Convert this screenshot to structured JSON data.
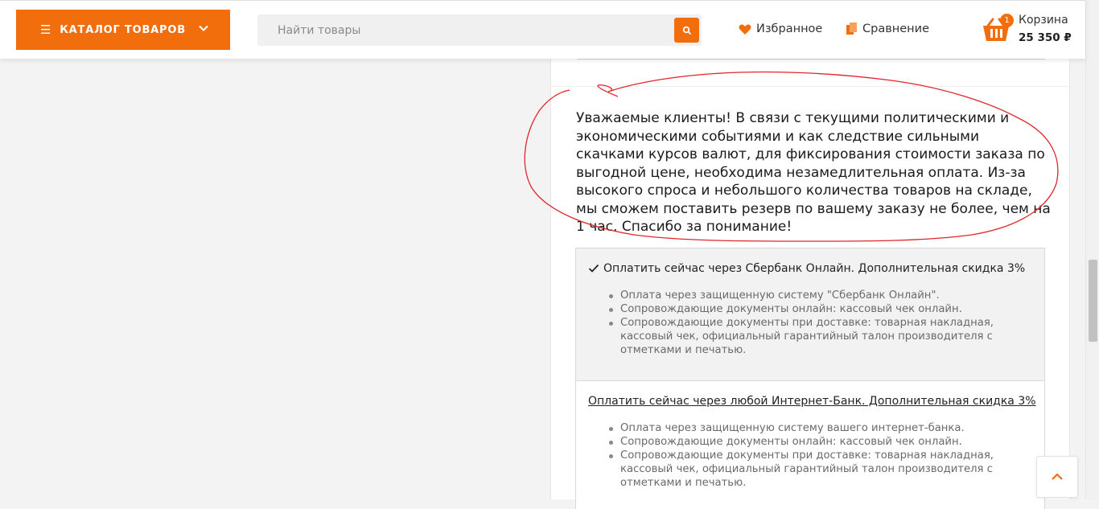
{
  "header": {
    "catalog_label": "КАТАЛОГ ТОВАРОВ",
    "search_placeholder": "Найти товары",
    "favorites_label": "Избранное",
    "compare_label": "Сравнение",
    "cart": {
      "label": "Корзина",
      "count": "1",
      "total": "25 350 ₽"
    }
  },
  "notice": {
    "text": "Уважаемые клиенты! В связи с текущими политическими и экономическими событиями и как следствие сильными скачками курсов валют, для фиксирования стоимости заказа по выгодной цене, необходима незамедлительная оплата. Из-за высокого спроса и небольшого количества товаров на складе, мы сможем поставить резерв по вашему заказу не более, чем на 1 час. Спасибо за понимание!"
  },
  "payment_options": [
    {
      "title": "Оплатить сейчас через Сбербанк Онлайн. Дополнительная скидка 3%",
      "selected": true,
      "items": [
        "Оплата через защищенную систему \"Сбербанк Онлайн\".",
        "Сопровождающие документы онлайн: кассовый чек онлайн.",
        "Сопровождающие документы при доставке: товарная накладная, кассовый чек, официальный гарантийный талон производителя с отметками и печатью."
      ]
    },
    {
      "title": "Оплатить сейчас через любой Интернет-Банк. Дополнительная скидка 3%",
      "selected": false,
      "items": [
        "Оплата через защищенную систему вашего интернет-банка.",
        "Сопровождающие документы онлайн: кассовый чек онлайн.",
        "Сопровождающие документы при доставке: товарная накладная, кассовый чек, официальный гарантийный талон производителя с отметками и печатью."
      ]
    }
  ],
  "colors": {
    "accent": "#f26d0c",
    "annotation": "#e0262b"
  },
  "icons": [
    "menu-icon",
    "chevron-down-icon",
    "search-icon",
    "heart-icon",
    "compare-icon",
    "cart-icon",
    "checkmark-icon",
    "arrow-up-icon"
  ]
}
